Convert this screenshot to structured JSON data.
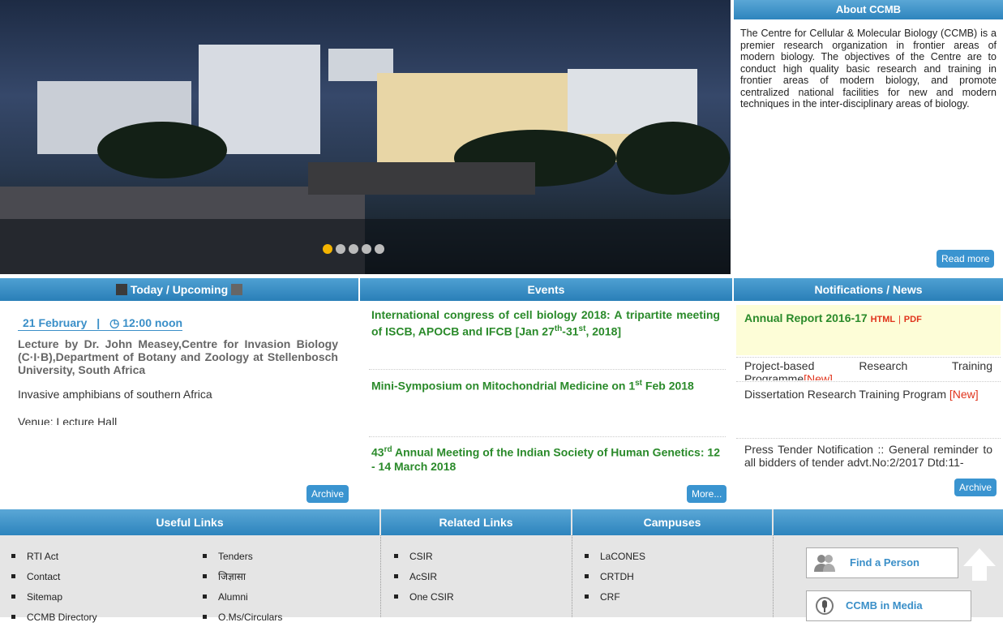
{
  "slider": {
    "dot_count": 5,
    "active_index": 0
  },
  "about": {
    "title": "About CCMB",
    "text": "The Centre for Cellular & Molecular Biology (CCMB) is a premier research organization in frontier areas of modern biology. The objectives of the Centre are to conduct high quality basic research and training in frontier areas of modern biology, and promote centralized national facilities for new and modern techniques in the inter-disciplinary areas of biology.",
    "read_more": "Read more"
  },
  "today": {
    "header": "Today / Upcoming",
    "date": "21 February",
    "separator": "|",
    "time": "12:00 noon",
    "lecture": "Lecture by Dr. John Measey,Centre for Invasion Biology (C·I·B),Department of Botany and Zoology at Stellenbosch University, South Africa",
    "talk_title": "Invasive amphibians of southern Africa",
    "venue": "Venue: Lecture Hall",
    "archive": "Archive"
  },
  "events": {
    "header": "Events",
    "items": [
      {
        "pre": "International congress of cell biology 2018: A tripartite meeting of ISCB, APOCB and IFCB [Jan 27",
        "sup1": "th",
        "mid": "-31",
        "sup2": "st",
        "post": ", 2018]"
      },
      {
        "pre": "Mini-Symposium on Mitochondrial Medicine on 1",
        "sup1": "st",
        "post": " Feb 2018"
      },
      {
        "pre": "43",
        "sup1": "rd",
        "post": " Annual Meeting of the Indian Society of Human Genetics: 12 - 14 March 2018"
      }
    ],
    "more": "More..."
  },
  "notifications": {
    "header": "Notifications / News",
    "annual_report": "Annual Report 2016-17",
    "html_link": "HTML",
    "link_sep": "|",
    "pdf_link": "PDF",
    "item1": "Project-based Research Training Programme",
    "new_tag": "[New]",
    "item2": "Dissertation Research Training Program",
    "item3": "Press Tender Notification :: General reminder to all bidders of tender advt.No:2/2017 Dtd:11-",
    "archive": "Archive"
  },
  "footer": {
    "useful_header": "Useful Links",
    "related_header": "Related Links",
    "campuses_header": "Campuses",
    "useful_col1": [
      "RTI Act",
      "Contact",
      "Sitemap",
      "CCMB Directory"
    ],
    "useful_col2": [
      "Tenders",
      "जिज्ञासा",
      "Alumni",
      "O.Ms/Circulars"
    ],
    "related": [
      "CSIR",
      "AcSIR",
      "One CSIR"
    ],
    "campuses": [
      "LaCONES",
      "CRTDH",
      "CRF"
    ],
    "find_person": "Find a Person",
    "in_media": "CCMB in Media"
  }
}
